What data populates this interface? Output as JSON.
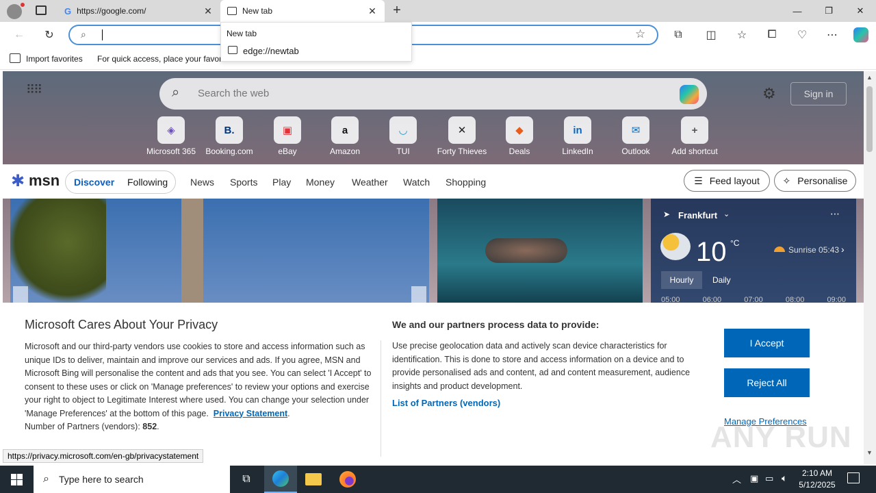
{
  "tabs": [
    {
      "title": "https://google.com/",
      "icon": "google-g-icon",
      "active": false
    },
    {
      "title": "New tab",
      "icon": "newtab-page-icon",
      "active": true
    }
  ],
  "address_bar": {
    "value": "",
    "placeholder": ""
  },
  "dropdown": {
    "header": "New tab",
    "suggestion": "edge://newtab"
  },
  "favorites_bar": {
    "import_label": "Import favorites",
    "hint": "For quick access, place your favori"
  },
  "ntp": {
    "search_placeholder": "Search the web",
    "sign_in": "Sign in",
    "shortcuts": [
      {
        "label": "Microsoft 365",
        "icon": "microsoft365-icon",
        "glyph": "◈",
        "color": "#6b4fbb"
      },
      {
        "label": "Booking.com",
        "icon": "booking-icon",
        "glyph": "B.",
        "color": "#003580"
      },
      {
        "label": "eBay",
        "icon": "ebay-icon",
        "glyph": "▣",
        "color": "#e53238"
      },
      {
        "label": "Amazon",
        "icon": "amazon-icon",
        "glyph": "a",
        "color": "#111111"
      },
      {
        "label": "TUI",
        "icon": "tui-icon",
        "glyph": "◡",
        "color": "#1a9ad6"
      },
      {
        "label": "Forty Thieves",
        "icon": "forty-thieves-icon",
        "glyph": "✕",
        "color": "#222222"
      },
      {
        "label": "Deals",
        "icon": "deals-icon",
        "glyph": "◆",
        "color": "#e85d1a"
      },
      {
        "label": "LinkedIn",
        "icon": "linkedin-icon",
        "glyph": "in",
        "color": "#0a66c2"
      },
      {
        "label": "Outlook",
        "icon": "outlook-icon",
        "glyph": "✉",
        "color": "#0f6cbd"
      },
      {
        "label": "Add shortcut",
        "icon": "plus-icon",
        "glyph": "+",
        "color": "#555555"
      }
    ],
    "msn": {
      "logo": "msn",
      "tabs": [
        "Discover",
        "Following"
      ],
      "nav": [
        "News",
        "Sports",
        "Play",
        "Money",
        "Weather",
        "Watch",
        "Shopping"
      ],
      "feed_layout": "Feed layout",
      "personalise": "Personalise"
    },
    "weather": {
      "city": "Frankfurt",
      "temp": "10",
      "unit": "°C",
      "sunrise": "Sunrise 05:43",
      "tabs": [
        "Hourly",
        "Daily"
      ],
      "hours": [
        "05:00",
        "06:00",
        "07:00",
        "08:00",
        "09:00"
      ]
    }
  },
  "privacy": {
    "title": "Microsoft Cares About Your Privacy",
    "body": "Microsoft and our third-party vendors use cookies to store and access information such as unique IDs to deliver, maintain and improve our services and ads. If you agree, MSN and Microsoft Bing will personalise the content and ads that you see. You can select 'I Accept' to consent to these uses or click on 'Manage preferences' to review your options and exercise your right to object to Legitimate Interest where used.  You can change your selection under 'Manage Preferences' at the bottom of this page.",
    "link": "Privacy Statement",
    "partners_label": "Number of Partners (vendors):",
    "partners_count": "852",
    "right_title": "We and our partners process data to provide:",
    "right_body": "Use precise geolocation data and actively scan device characteristics for identification. This is done to store and access information on a device and to provide personalised ads and content, ad and content measurement, audience insights and product development.",
    "partners_link": "List of Partners (vendors)",
    "accept": "I Accept",
    "reject": "Reject All",
    "manage": "Manage Preferences"
  },
  "status_url": "https://privacy.microsoft.com/en-gb/privacystatement",
  "taskbar": {
    "search_placeholder": "Type here to search",
    "time": "2:10 AM",
    "date": "5/12/2025"
  },
  "watermark": "ANY RUN"
}
